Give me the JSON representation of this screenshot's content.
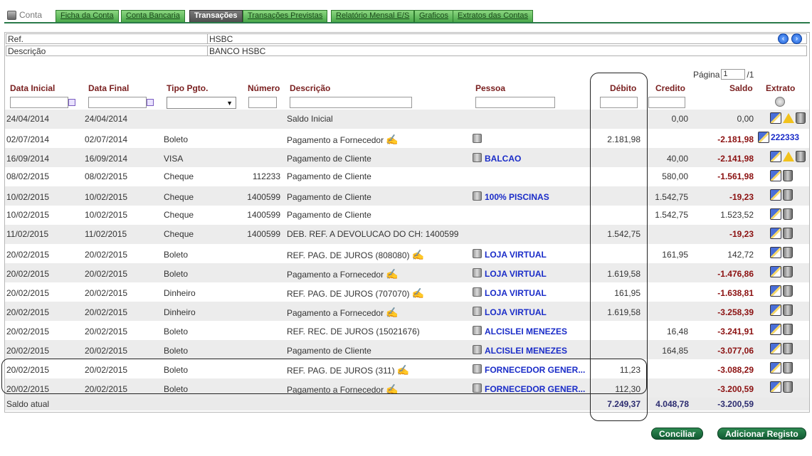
{
  "tabs": {
    "conta": "Conta",
    "items": [
      "Ficha da Conta",
      "Conta Bancaria",
      "Transações",
      "Transações Previstas",
      "Relatório Mensal E/S",
      "Graficos",
      "Extratos das Contas"
    ]
  },
  "info": {
    "ref_label": "Ref.",
    "ref_value": "HSBC",
    "desc_label": "Descrição",
    "desc_value": "BANCO HSBC"
  },
  "pagination": {
    "label": "Página",
    "current": "1",
    "total": "/1"
  },
  "columns": [
    "Data Inicial",
    "Data Final",
    "Tipo Pgto.",
    "Número",
    "Descrição",
    "Pessoa",
    "Débito",
    "Credito",
    "Saldo",
    "Extrato"
  ],
  "rows": [
    {
      "d1": "24/04/2014",
      "d2": "24/04/2014",
      "tipo": "",
      "num": "",
      "desc": "Saldo Inicial",
      "hand": false,
      "pessoa": "",
      "picon": false,
      "deb": "",
      "cred": "0,00",
      "saldo": "0,00",
      "neg": false,
      "warn": true,
      "extra": ""
    },
    {
      "d1": "02/07/2014",
      "d2": "02/07/2014",
      "tipo": "Boleto",
      "num": "",
      "desc": "Pagamento a Fornecedor",
      "hand": true,
      "pessoa": "",
      "picon": true,
      "deb": "2.181,98",
      "cred": "",
      "saldo": "-2.181,98",
      "neg": true,
      "warn": false,
      "extra": "222333"
    },
    {
      "d1": "16/09/2014",
      "d2": "16/09/2014",
      "tipo": "VISA",
      "num": "",
      "desc": "Pagamento de Cliente",
      "hand": false,
      "pessoa": "BALCAO",
      "picon": true,
      "deb": "",
      "cred": "40,00",
      "saldo": "-2.141,98",
      "neg": true,
      "warn": true,
      "extra": ""
    },
    {
      "d1": "08/02/2015",
      "d2": "08/02/2015",
      "tipo": "Cheque",
      "num": "112233",
      "desc": "Pagamento de Cliente",
      "hand": false,
      "pessoa": "",
      "picon": false,
      "deb": "",
      "cred": "580,00",
      "saldo": "-1.561,98",
      "neg": true,
      "warn": false,
      "extra": ""
    },
    {
      "d1": "10/02/2015",
      "d2": "10/02/2015",
      "tipo": "Cheque",
      "num": "1400599",
      "desc": "Pagamento de Cliente",
      "hand": false,
      "pessoa": "100% PISCINAS",
      "picon": true,
      "deb": "",
      "cred": "1.542,75",
      "saldo": "-19,23",
      "neg": true,
      "warn": false,
      "extra": ""
    },
    {
      "d1": "10/02/2015",
      "d2": "10/02/2015",
      "tipo": "Cheque",
      "num": "1400599",
      "desc": "Pagamento de Cliente",
      "hand": false,
      "pessoa": "",
      "picon": false,
      "deb": "",
      "cred": "1.542,75",
      "saldo": "1.523,52",
      "neg": false,
      "warn": false,
      "extra": ""
    },
    {
      "d1": "11/02/2015",
      "d2": "11/02/2015",
      "tipo": "Cheque",
      "num": "1400599",
      "desc": "DEB. REF. A DEVOLUCAO DO CH: 1400599",
      "hand": false,
      "pessoa": "",
      "picon": false,
      "deb": "1.542,75",
      "cred": "",
      "saldo": "-19,23",
      "neg": true,
      "warn": false,
      "extra": ""
    },
    {
      "d1": "20/02/2015",
      "d2": "20/02/2015",
      "tipo": "Boleto",
      "num": "",
      "desc": "REF. PAG. DE JUROS (808080)",
      "hand": true,
      "pessoa": "LOJA VIRTUAL",
      "picon": true,
      "deb": "",
      "cred": "161,95",
      "saldo": "142,72",
      "neg": false,
      "warn": false,
      "extra": ""
    },
    {
      "d1": "20/02/2015",
      "d2": "20/02/2015",
      "tipo": "Boleto",
      "num": "",
      "desc": "Pagamento a Fornecedor",
      "hand": true,
      "pessoa": "LOJA VIRTUAL",
      "picon": true,
      "deb": "1.619,58",
      "cred": "",
      "saldo": "-1.476,86",
      "neg": true,
      "warn": false,
      "extra": ""
    },
    {
      "d1": "20/02/2015",
      "d2": "20/02/2015",
      "tipo": "Dinheiro",
      "num": "",
      "desc": "REF. PAG. DE JUROS (707070)",
      "hand": true,
      "pessoa": "LOJA VIRTUAL",
      "picon": true,
      "deb": "161,95",
      "cred": "",
      "saldo": "-1.638,81",
      "neg": true,
      "warn": false,
      "extra": ""
    },
    {
      "d1": "20/02/2015",
      "d2": "20/02/2015",
      "tipo": "Dinheiro",
      "num": "",
      "desc": "Pagamento a Fornecedor",
      "hand": true,
      "pessoa": "LOJA VIRTUAL",
      "picon": true,
      "deb": "1.619,58",
      "cred": "",
      "saldo": "-3.258,39",
      "neg": true,
      "warn": false,
      "extra": ""
    },
    {
      "d1": "20/02/2015",
      "d2": "20/02/2015",
      "tipo": "Boleto",
      "num": "",
      "desc": "REF. REC. DE JUROS (15021676)",
      "hand": false,
      "pessoa": "ALCISLEI MENEZES",
      "picon": true,
      "deb": "",
      "cred": "16,48",
      "saldo": "-3.241,91",
      "neg": true,
      "warn": false,
      "extra": ""
    },
    {
      "d1": "20/02/2015",
      "d2": "20/02/2015",
      "tipo": "Boleto",
      "num": "",
      "desc": "Pagamento de Cliente",
      "hand": false,
      "pessoa": "ALCISLEI MENEZES",
      "picon": true,
      "deb": "",
      "cred": "164,85",
      "saldo": "-3.077,06",
      "neg": true,
      "warn": false,
      "extra": ""
    },
    {
      "d1": "20/02/2015",
      "d2": "20/02/2015",
      "tipo": "Boleto",
      "num": "",
      "desc": "REF. PAG. DE JUROS (311)",
      "hand": true,
      "pessoa": "FORNECEDOR GENER...",
      "picon": true,
      "deb": "11,23",
      "cred": "",
      "saldo": "-3.088,29",
      "neg": true,
      "warn": false,
      "extra": ""
    },
    {
      "d1": "20/02/2015",
      "d2": "20/02/2015",
      "tipo": "Boleto",
      "num": "",
      "desc": "Pagamento a Fornecedor",
      "hand": true,
      "pessoa": "FORNECEDOR GENER...",
      "picon": true,
      "deb": "112,30",
      "cred": "",
      "saldo": "-3.200,59",
      "neg": true,
      "warn": false,
      "extra": ""
    }
  ],
  "totals": {
    "label": "Saldo atual",
    "debito": "7.249,37",
    "credito": "4.048,78",
    "saldo": "-3.200,59"
  },
  "buttons": {
    "conciliar": "Conciliar",
    "adicionar": "Adicionar Registo"
  }
}
